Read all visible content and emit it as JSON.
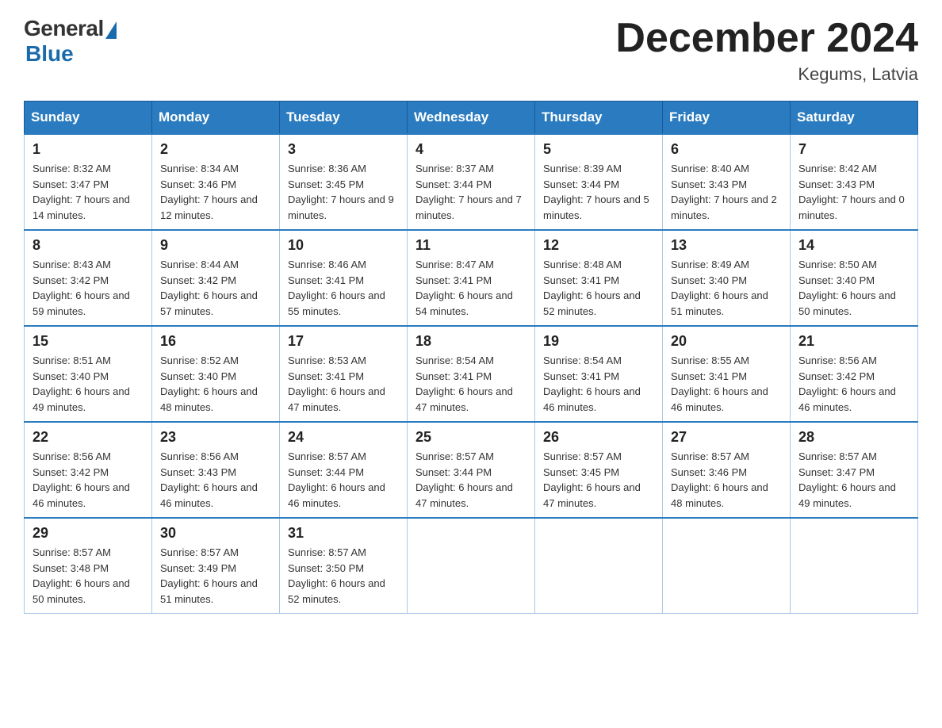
{
  "header": {
    "logo": {
      "general_text": "General",
      "blue_text": "Blue"
    },
    "title": "December 2024",
    "location": "Kegums, Latvia"
  },
  "calendar": {
    "weekdays": [
      "Sunday",
      "Monday",
      "Tuesday",
      "Wednesday",
      "Thursday",
      "Friday",
      "Saturday"
    ],
    "weeks": [
      [
        {
          "day": 1,
          "sunrise": "8:32 AM",
          "sunset": "3:47 PM",
          "daylight": "7 hours and 14 minutes."
        },
        {
          "day": 2,
          "sunrise": "8:34 AM",
          "sunset": "3:46 PM",
          "daylight": "7 hours and 12 minutes."
        },
        {
          "day": 3,
          "sunrise": "8:36 AM",
          "sunset": "3:45 PM",
          "daylight": "7 hours and 9 minutes."
        },
        {
          "day": 4,
          "sunrise": "8:37 AM",
          "sunset": "3:44 PM",
          "daylight": "7 hours and 7 minutes."
        },
        {
          "day": 5,
          "sunrise": "8:39 AM",
          "sunset": "3:44 PM",
          "daylight": "7 hours and 5 minutes."
        },
        {
          "day": 6,
          "sunrise": "8:40 AM",
          "sunset": "3:43 PM",
          "daylight": "7 hours and 2 minutes."
        },
        {
          "day": 7,
          "sunrise": "8:42 AM",
          "sunset": "3:43 PM",
          "daylight": "7 hours and 0 minutes."
        }
      ],
      [
        {
          "day": 8,
          "sunrise": "8:43 AM",
          "sunset": "3:42 PM",
          "daylight": "6 hours and 59 minutes."
        },
        {
          "day": 9,
          "sunrise": "8:44 AM",
          "sunset": "3:42 PM",
          "daylight": "6 hours and 57 minutes."
        },
        {
          "day": 10,
          "sunrise": "8:46 AM",
          "sunset": "3:41 PM",
          "daylight": "6 hours and 55 minutes."
        },
        {
          "day": 11,
          "sunrise": "8:47 AM",
          "sunset": "3:41 PM",
          "daylight": "6 hours and 54 minutes."
        },
        {
          "day": 12,
          "sunrise": "8:48 AM",
          "sunset": "3:41 PM",
          "daylight": "6 hours and 52 minutes."
        },
        {
          "day": 13,
          "sunrise": "8:49 AM",
          "sunset": "3:40 PM",
          "daylight": "6 hours and 51 minutes."
        },
        {
          "day": 14,
          "sunrise": "8:50 AM",
          "sunset": "3:40 PM",
          "daylight": "6 hours and 50 minutes."
        }
      ],
      [
        {
          "day": 15,
          "sunrise": "8:51 AM",
          "sunset": "3:40 PM",
          "daylight": "6 hours and 49 minutes."
        },
        {
          "day": 16,
          "sunrise": "8:52 AM",
          "sunset": "3:40 PM",
          "daylight": "6 hours and 48 minutes."
        },
        {
          "day": 17,
          "sunrise": "8:53 AM",
          "sunset": "3:41 PM",
          "daylight": "6 hours and 47 minutes."
        },
        {
          "day": 18,
          "sunrise": "8:54 AM",
          "sunset": "3:41 PM",
          "daylight": "6 hours and 47 minutes."
        },
        {
          "day": 19,
          "sunrise": "8:54 AM",
          "sunset": "3:41 PM",
          "daylight": "6 hours and 46 minutes."
        },
        {
          "day": 20,
          "sunrise": "8:55 AM",
          "sunset": "3:41 PM",
          "daylight": "6 hours and 46 minutes."
        },
        {
          "day": 21,
          "sunrise": "8:56 AM",
          "sunset": "3:42 PM",
          "daylight": "6 hours and 46 minutes."
        }
      ],
      [
        {
          "day": 22,
          "sunrise": "8:56 AM",
          "sunset": "3:42 PM",
          "daylight": "6 hours and 46 minutes."
        },
        {
          "day": 23,
          "sunrise": "8:56 AM",
          "sunset": "3:43 PM",
          "daylight": "6 hours and 46 minutes."
        },
        {
          "day": 24,
          "sunrise": "8:57 AM",
          "sunset": "3:44 PM",
          "daylight": "6 hours and 46 minutes."
        },
        {
          "day": 25,
          "sunrise": "8:57 AM",
          "sunset": "3:44 PM",
          "daylight": "6 hours and 47 minutes."
        },
        {
          "day": 26,
          "sunrise": "8:57 AM",
          "sunset": "3:45 PM",
          "daylight": "6 hours and 47 minutes."
        },
        {
          "day": 27,
          "sunrise": "8:57 AM",
          "sunset": "3:46 PM",
          "daylight": "6 hours and 48 minutes."
        },
        {
          "day": 28,
          "sunrise": "8:57 AM",
          "sunset": "3:47 PM",
          "daylight": "6 hours and 49 minutes."
        }
      ],
      [
        {
          "day": 29,
          "sunrise": "8:57 AM",
          "sunset": "3:48 PM",
          "daylight": "6 hours and 50 minutes."
        },
        {
          "day": 30,
          "sunrise": "8:57 AM",
          "sunset": "3:49 PM",
          "daylight": "6 hours and 51 minutes."
        },
        {
          "day": 31,
          "sunrise": "8:57 AM",
          "sunset": "3:50 PM",
          "daylight": "6 hours and 52 minutes."
        },
        null,
        null,
        null,
        null
      ]
    ]
  }
}
